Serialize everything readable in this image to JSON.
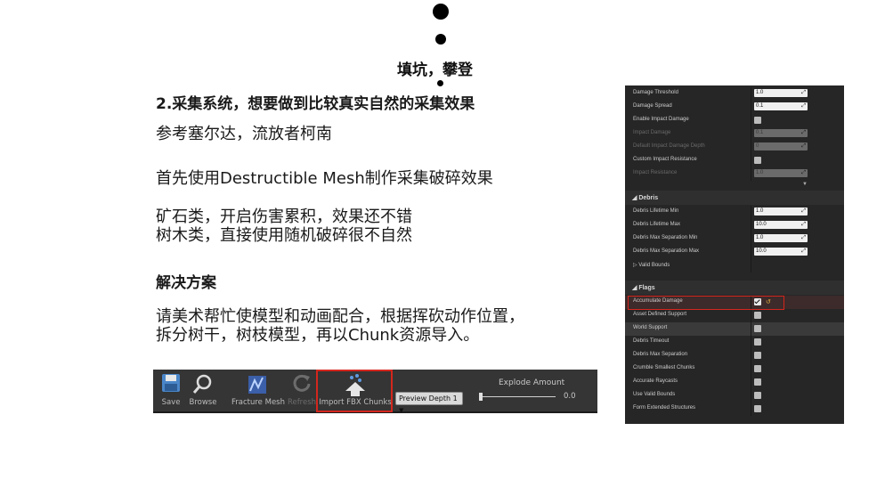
{
  "doc": {
    "top_heading": "填坑，攀登",
    "line1": "2.采集系统，想要做到比较真实自然的采集效果",
    "line2": "参考塞尔达，流放者柯南",
    "line3": "首先使用Destructible Mesh制作采集破碎效果",
    "line4": "矿石类，开启伤害累积，效果还不错",
    "line5": "树木类，直接使用随机破碎很不自然",
    "line6": "解决方案",
    "line7": "请美术帮忙使模型和动画配合，根据挥砍动作位置，",
    "line8": "拆分树干，树枝模型，再以Chunk资源导入。"
  },
  "toolbar": {
    "save_label": "Save",
    "browse_label": "Browse",
    "fracture_label": "Fracture Mesh",
    "refresh_label": "Refresh",
    "import_label": "Import FBX Chunks",
    "preview_depth_label": "Preview Depth 1",
    "explode_label": "Explode Amount",
    "explode_value": "0.0",
    "explode_fraction": 0.0
  },
  "panel": {
    "rows_top": [
      {
        "name": "Damage Threshold",
        "type": "num",
        "value": "1.0",
        "dim": false
      },
      {
        "name": "Damage Spread",
        "type": "num",
        "value": "0.1",
        "dim": false
      },
      {
        "name": "Enable Impact Damage",
        "type": "chk",
        "checked": false,
        "dim": false
      },
      {
        "name": "Impact Damage",
        "type": "num",
        "value": "0.1",
        "dim": true
      },
      {
        "name": "Default Impact Damage Depth",
        "type": "num",
        "value": "0",
        "dim": true
      },
      {
        "name": "Custom Impact Resistance",
        "type": "chk",
        "checked": false,
        "dim": false
      },
      {
        "name": "Impact Resistance",
        "type": "num",
        "value": "1.0",
        "dim": true
      }
    ],
    "debris_label": "Debris",
    "rows_debris": [
      {
        "name": "Debris Lifetime Min",
        "type": "num",
        "value": "1.0",
        "dim": false
      },
      {
        "name": "Debris Lifetime Max",
        "type": "num",
        "value": "10.0",
        "dim": false
      },
      {
        "name": "Debris Max Separation Min",
        "type": "num",
        "value": "1.0",
        "dim": false
      },
      {
        "name": "Debris Max Separation Max",
        "type": "num",
        "value": "10.0",
        "dim": false
      },
      {
        "name": "Valid Bounds",
        "type": "none",
        "dim": false
      }
    ],
    "flags_label": "Flags",
    "rows_flags": [
      {
        "name": "Accumulate Damage",
        "type": "chk",
        "checked": true,
        "dim": false
      },
      {
        "name": "Asset Defined Support",
        "type": "chk",
        "checked": false,
        "dim": false
      },
      {
        "name": "World Support",
        "type": "chk",
        "checked": false,
        "dim": false
      },
      {
        "name": "Debris Timeout",
        "type": "chk",
        "checked": false,
        "dim": false
      },
      {
        "name": "Debris Max Separation",
        "type": "chk",
        "checked": false,
        "dim": false
      },
      {
        "name": "Crumble Smallest Chunks",
        "type": "chk",
        "checked": false,
        "dim": false
      },
      {
        "name": "Accurate Raycasts",
        "type": "chk",
        "checked": false,
        "dim": false
      },
      {
        "name": "Use Valid Bounds",
        "type": "chk",
        "checked": false,
        "dim": false
      },
      {
        "name": "Form Extended Structures",
        "type": "chk",
        "checked": false,
        "dim": false
      }
    ]
  },
  "colors": {
    "highlight_red": "#d4261d",
    "panel_bg": "#262626",
    "toolbar_bg": "#353535"
  }
}
